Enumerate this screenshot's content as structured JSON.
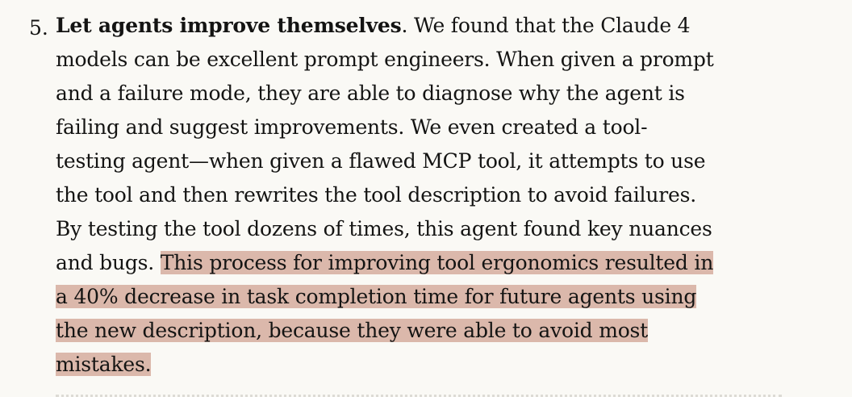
{
  "list_item": {
    "number": "5.",
    "lead": "Let agents improve themselves",
    "lines": [
      [
        {
          "text": ". We found that the Claude 4",
          "highlight": false
        }
      ],
      [
        {
          "text": "models can be excellent prompt engineers. When given a prompt",
          "highlight": false
        }
      ],
      [
        {
          "text": "and a failure mode, they are able to diagnose why the agent is",
          "highlight": false
        }
      ],
      [
        {
          "text": "failing and suggest improvements. We even created a tool-",
          "highlight": false
        }
      ],
      [
        {
          "text": "testing agent—when given a flawed MCP tool, it attempts to use",
          "highlight": false
        }
      ],
      [
        {
          "text": "the tool and then rewrites the tool description to avoid failures.",
          "highlight": false
        }
      ],
      [
        {
          "text": "By testing the tool dozens of times, this agent found key nuances",
          "highlight": false
        }
      ],
      [
        {
          "text": "and bugs. ",
          "highlight": false
        },
        {
          "text": "This process for improving tool ergonomics resulted in",
          "highlight": true
        }
      ],
      [
        {
          "text": "a 40% decrease in task completion time for future agents using",
          "highlight": true
        }
      ],
      [
        {
          "text": "the new description, because they were able to avoid most",
          "highlight": true
        }
      ],
      [
        {
          "text": "mistakes.",
          "highlight": true
        }
      ]
    ]
  },
  "colors": {
    "background": "#faf9f5",
    "text": "#141413",
    "highlight": "#dbb8ab"
  }
}
